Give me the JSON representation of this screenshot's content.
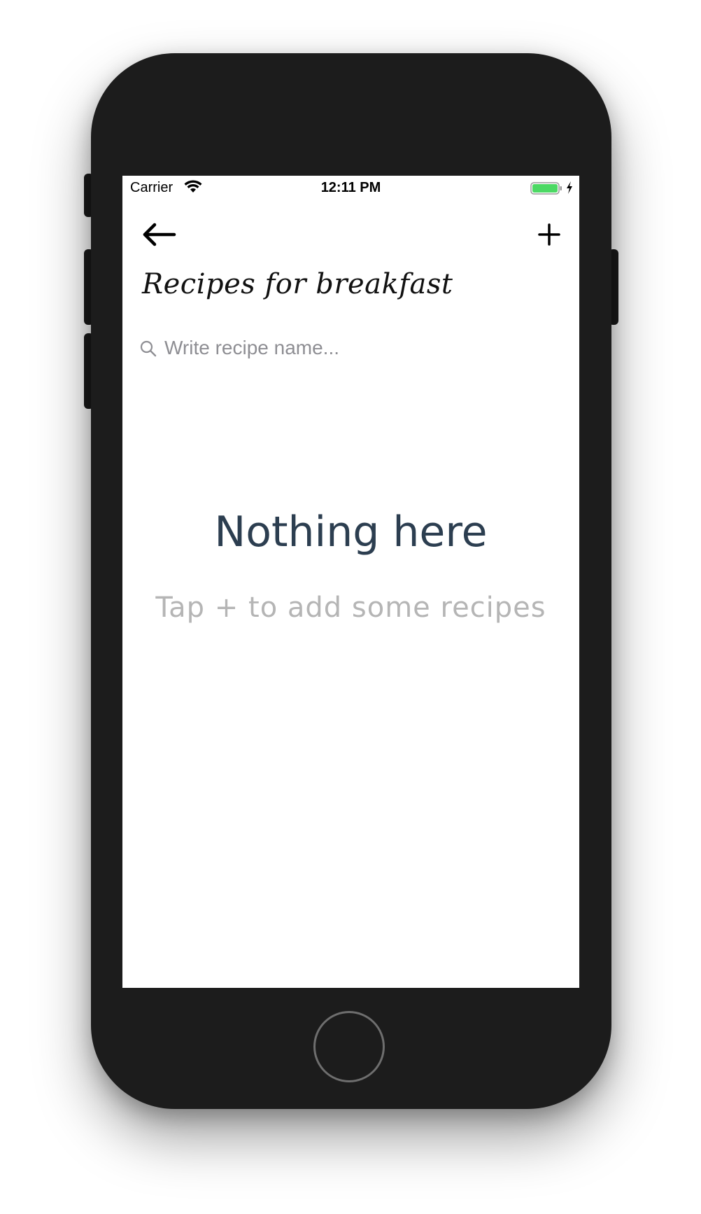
{
  "status_bar": {
    "carrier": "Carrier",
    "time": "12:11 PM",
    "wifi_icon": "wifi-icon",
    "battery_icon": "battery-icon",
    "battery_color": "#4cd964"
  },
  "nav": {
    "back_icon": "arrow-left-icon",
    "add_icon": "plus-icon"
  },
  "page": {
    "title": "Recipes for breakfast"
  },
  "search": {
    "placeholder": "Write recipe name...",
    "value": ""
  },
  "empty_state": {
    "title": "Nothing here",
    "subtitle": "Tap + to add some recipes",
    "title_color": "#2c3e50",
    "subtitle_color": "#b5b5b5"
  }
}
